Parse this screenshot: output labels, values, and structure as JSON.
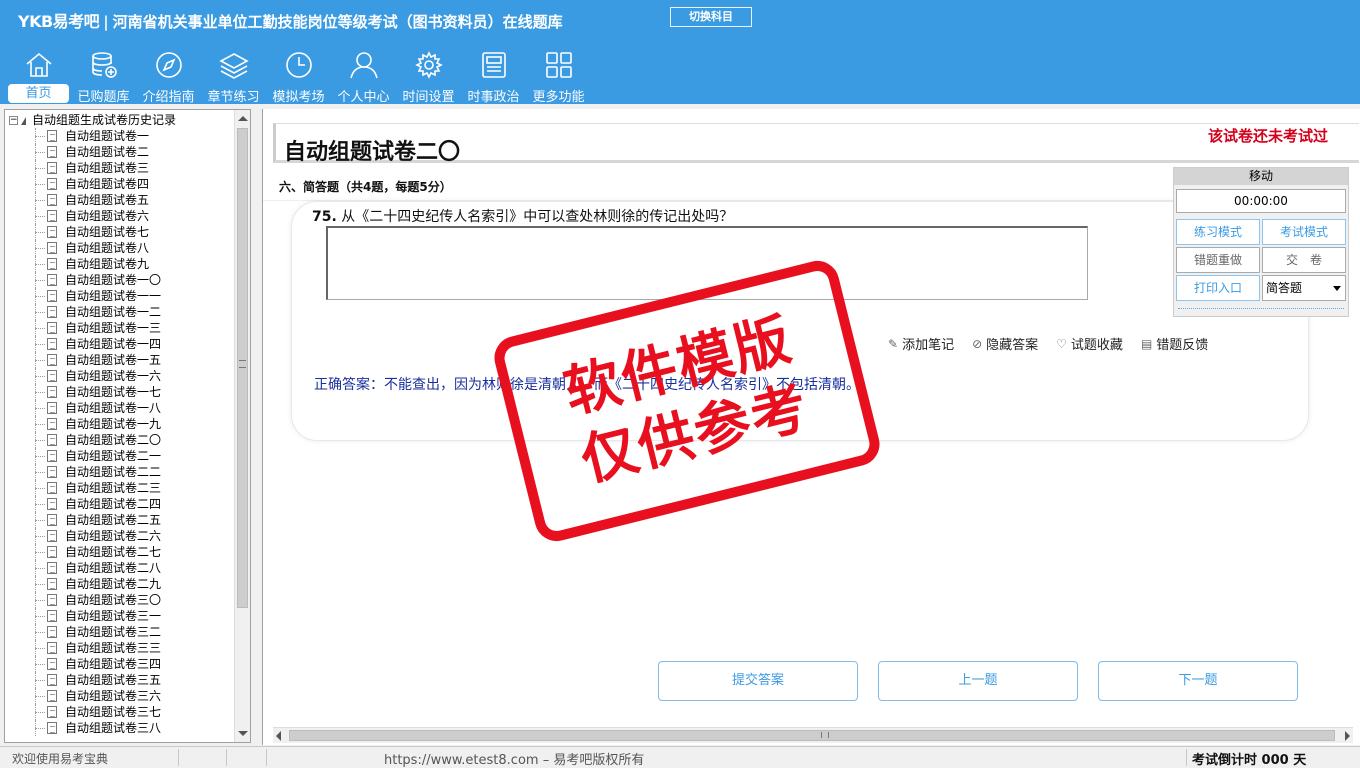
{
  "header": {
    "brand": "YKB易考吧",
    "title": "河南省机关事业单位工勤技能岗位等级考试（图书资料员）在线题库",
    "switch_label": "切换科目"
  },
  "nav": [
    {
      "label": "首页",
      "icon": "home-icon",
      "active": true
    },
    {
      "label": "已购题库",
      "icon": "database-icon"
    },
    {
      "label": "介绍指南",
      "icon": "compass-icon"
    },
    {
      "label": "章节练习",
      "icon": "layers-icon"
    },
    {
      "label": "模拟考场",
      "icon": "clock-icon"
    },
    {
      "label": "个人中心",
      "icon": "user-icon"
    },
    {
      "label": "时间设置",
      "icon": "gear-icon"
    },
    {
      "label": "时事政治",
      "icon": "news-icon"
    },
    {
      "label": "更多功能",
      "icon": "grid-icon"
    }
  ],
  "tree": {
    "root": "自动组题生成试卷历史记录",
    "items": [
      "自动组题试卷一",
      "自动组题试卷二",
      "自动组题试卷三",
      "自动组题试卷四",
      "自动组题试卷五",
      "自动组题试卷六",
      "自动组题试卷七",
      "自动组题试卷八",
      "自动组题试卷九",
      "自动组题试卷一〇",
      "自动组题试卷一一",
      "自动组题试卷一二",
      "自动组题试卷一三",
      "自动组题试卷一四",
      "自动组题试卷一五",
      "自动组题试卷一六",
      "自动组题试卷一七",
      "自动组题试卷一八",
      "自动组题试卷一九",
      "自动组题试卷二〇",
      "自动组题试卷二一",
      "自动组题试卷二二",
      "自动组题试卷二三",
      "自动组题试卷二四",
      "自动组题试卷二五",
      "自动组题试卷二六",
      "自动组题试卷二七",
      "自动组题试卷二八",
      "自动组题试卷二九",
      "自动组题试卷三〇",
      "自动组题试卷三一",
      "自动组题试卷三二",
      "自动组题试卷三三",
      "自动组题试卷三四",
      "自动组题试卷三五",
      "自动组题试卷三六",
      "自动组题试卷三七",
      "自动组题试卷三八"
    ]
  },
  "paper": {
    "title": "自动组题试卷二〇",
    "status": "该试卷还未考试过",
    "section": "六、简答题（共4题，每题5分）"
  },
  "question": {
    "number": "75.",
    "text": "从《二十四史纪传人名索引》中可以查处林则徐的传记出处吗？",
    "answer_value": "",
    "correct_answer": "正确答案：不能查出，因为林则徐是清朝人，而《二十四史纪传人名索引》不包括清朝。"
  },
  "tools": {
    "add_note": "添加笔记",
    "hide_answer": "隐藏答案",
    "favorite": "试题收藏",
    "feedback": "错题反馈"
  },
  "widget": {
    "title": "移动",
    "timer": "00:00:00",
    "practice_mode": "练习模式",
    "exam_mode": "考试模式",
    "redo_wrong": "错题重做",
    "submit_paper": "交　卷",
    "print_entry": "打印入口",
    "type_select": "简答题"
  },
  "actions": {
    "submit": "提交答案",
    "prev": "上一题",
    "next": "下一题"
  },
  "status": {
    "left": "欢迎使用易考宝典",
    "center": "https://www.etest8.com – 易考吧版权所有",
    "right": "考试倒计时 000 天"
  },
  "watermark": {
    "line1": "软件模版",
    "line2": "仅供参考"
  },
  "colors": {
    "header": "#3a9be3",
    "status_red": "#d4001b",
    "answer_blue": "#1a2f9e",
    "stamp_red": "#e8101e"
  }
}
